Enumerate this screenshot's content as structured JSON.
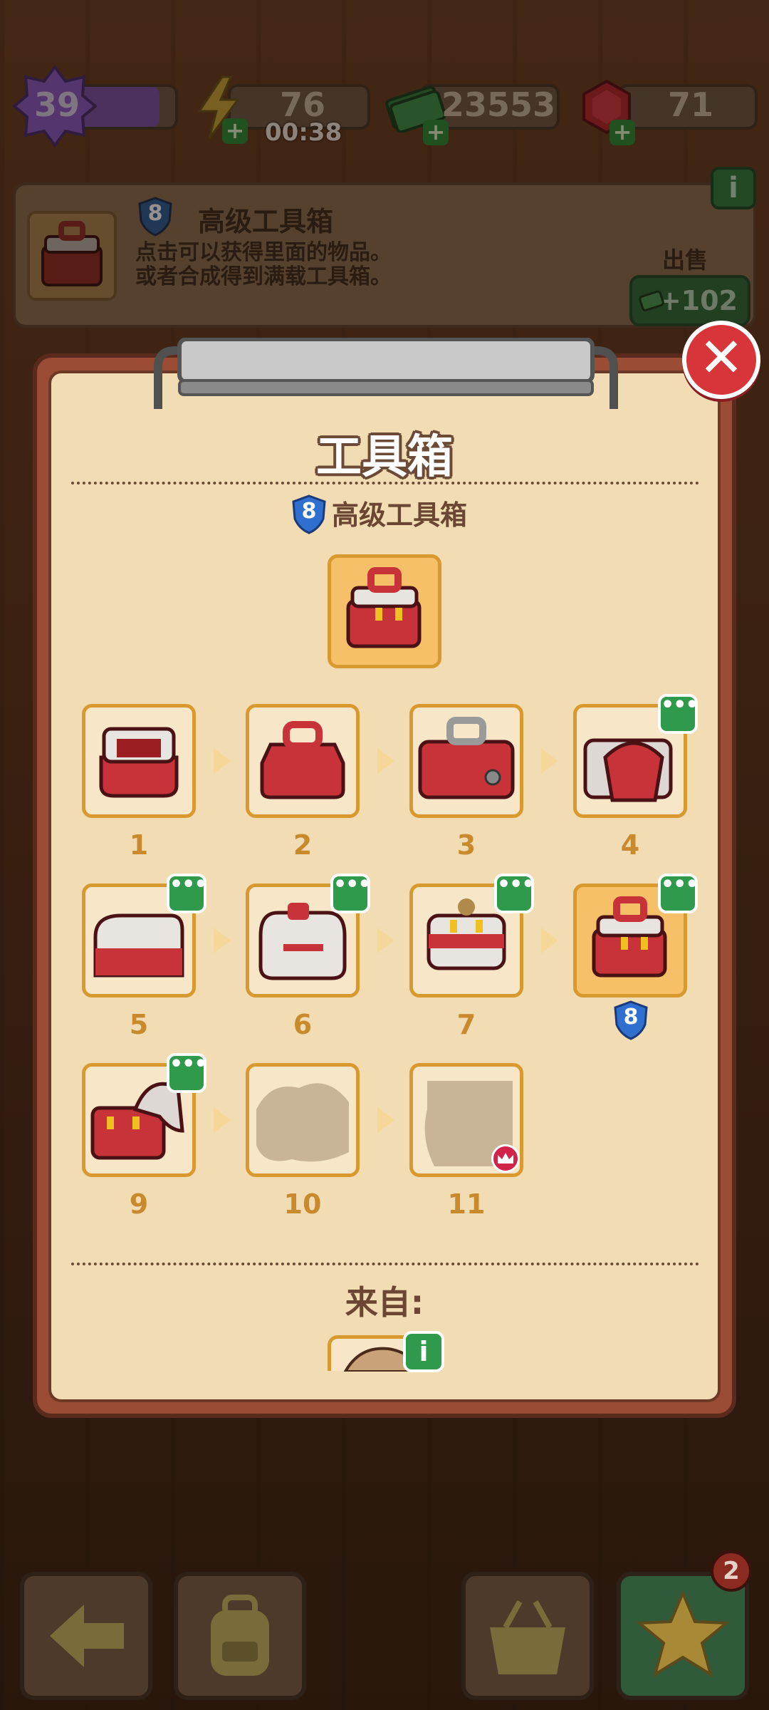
{
  "hud": {
    "level": "39",
    "energy": "76",
    "energy_timer": "00:38",
    "cash": "23553",
    "gems": "71"
  },
  "info_card": {
    "tier": "8",
    "title": "高级工具箱",
    "description_line1": "点击可以获得里面的物品。",
    "description_line2": "或者合成得到满载工具箱。",
    "sell_label": "出售",
    "sell_value": "+102"
  },
  "panel": {
    "title": "工具箱",
    "subtitle_tier": "8",
    "subtitle": "高级工具箱",
    "from_label": "来自:",
    "chain": [
      {
        "num": "1"
      },
      {
        "num": "2"
      },
      {
        "num": "3"
      },
      {
        "num": "4"
      },
      {
        "num": "5"
      },
      {
        "num": "6"
      },
      {
        "num": "7"
      },
      {
        "num": "8"
      },
      {
        "num": "9"
      },
      {
        "num": "10"
      },
      {
        "num": "11"
      }
    ]
  },
  "bottom": {
    "badge_count": "2"
  },
  "colors": {
    "accent_red": "#d8353b",
    "slot_border": "#d8992e",
    "paper": "#f2dcb4",
    "shield_blue": "#2f6fd0",
    "more_green": "#2f9a4b"
  }
}
